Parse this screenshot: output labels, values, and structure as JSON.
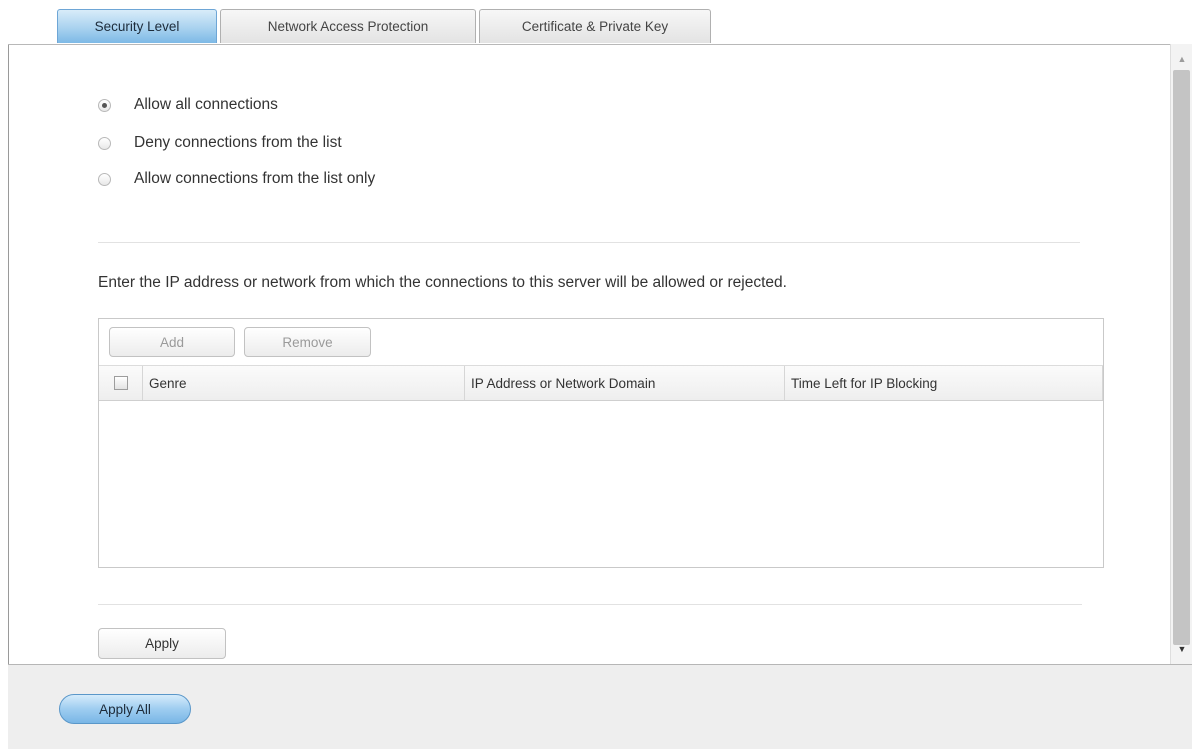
{
  "tabs": [
    {
      "label": "Security Level",
      "active": true
    },
    {
      "label": "Network Access Protection",
      "active": false
    },
    {
      "label": "Certificate & Private Key",
      "active": false
    }
  ],
  "security_options": [
    {
      "label": "Allow all connections",
      "checked": true
    },
    {
      "label": "Deny connections from the list",
      "checked": false
    },
    {
      "label": "Allow connections from the list only",
      "checked": false
    }
  ],
  "description": "Enter the IP address or network from which the connections to this server will be allowed or rejected.",
  "grid": {
    "add_label": "Add",
    "remove_label": "Remove",
    "columns": [
      "Genre",
      "IP Address or Network Domain",
      "Time Left for IP Blocking"
    ],
    "rows": []
  },
  "apply_label": "Apply",
  "apply_all_label": "Apply All",
  "colors": {
    "active_tab": "#a9d2ef",
    "apply_all_button": "#9ecdf0"
  }
}
